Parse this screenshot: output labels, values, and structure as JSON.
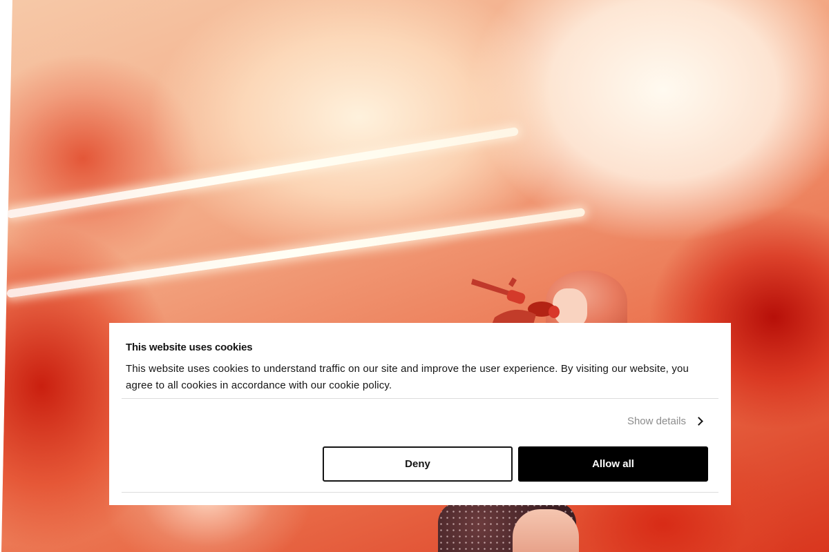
{
  "cookie_banner": {
    "title": "This website uses cookies",
    "body": "This website uses cookies to understand traffic on our site and improve the user experience. By visiting our website, you agree to all cookies in accordance with our cookie policy.",
    "show_details_label": "Show details",
    "deny_label": "Deny",
    "allow_label": "Allow all",
    "show_details_icon": "chevron-right-icon"
  },
  "colors": {
    "banner_background": "#ffffff",
    "text": "#141414",
    "muted_text": "#8c8c8c",
    "primary_button": "#000000",
    "primary_button_text": "#ffffff",
    "divider": "#dcdcdc"
  }
}
